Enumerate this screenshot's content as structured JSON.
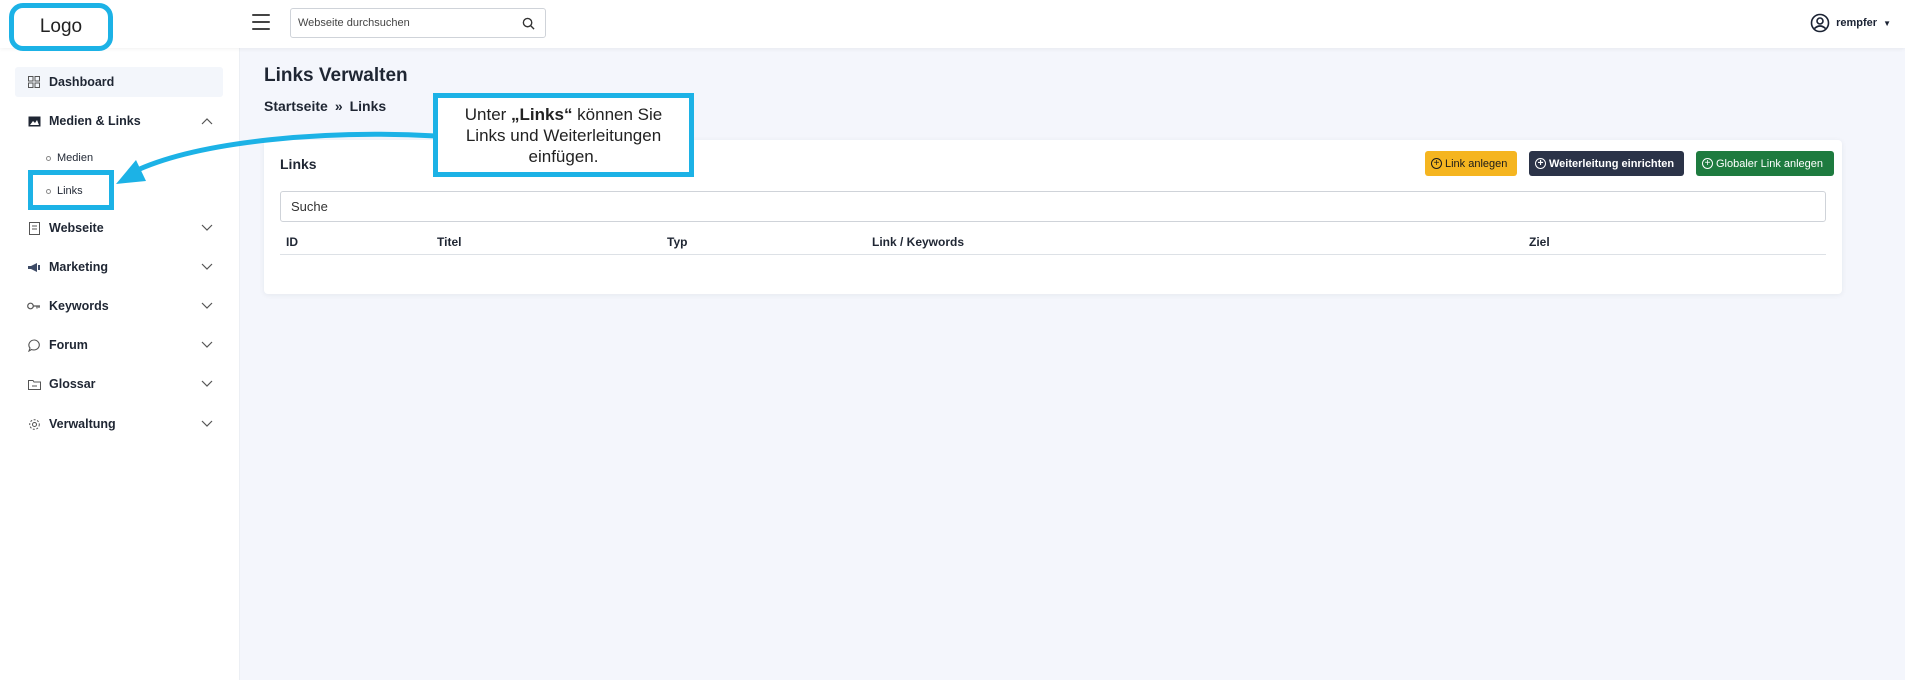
{
  "colors": {
    "accent": "#1cb2e6",
    "warning": "#f5b520",
    "dark": "#2b3348",
    "success": "#1e7b3f",
    "page_bg": "#f4f6fc"
  },
  "logo": {
    "text": "Logo"
  },
  "header": {
    "menu_icon": "hamburger-icon",
    "search": {
      "placeholder": "Webseite durchsuchen",
      "value": "",
      "icon": "search-icon"
    },
    "user": {
      "name": "rempfer",
      "icon": "user-circle-icon"
    }
  },
  "sidebar": {
    "items": [
      {
        "label": "Dashboard",
        "icon": "grid-icon"
      },
      {
        "label": "Medien & Links",
        "icon": "image-icon",
        "expanded": true
      },
      {
        "label": "Webseite",
        "icon": "document-icon"
      },
      {
        "label": "Marketing",
        "icon": "megaphone-icon"
      },
      {
        "label": "Keywords",
        "icon": "key-icon"
      },
      {
        "label": "Forum",
        "icon": "chat-icon"
      },
      {
        "label": "Glossar",
        "icon": "folder-icon"
      },
      {
        "label": "Verwaltung",
        "icon": "gear-icon"
      }
    ],
    "sub_items": [
      {
        "label": "Medien"
      },
      {
        "label": "Links"
      }
    ]
  },
  "main": {
    "title": "Links Verwalten",
    "breadcrumb": {
      "home": "Startseite",
      "separator": "»",
      "current": "Links"
    },
    "card": {
      "title": "Links",
      "buttons": {
        "create_link": "Link anlegen",
        "create_redirect": "Weiterleitung einrichten",
        "create_global_link": "Globaler Link anlegen"
      },
      "search_placeholder": "Suche",
      "columns": [
        "ID",
        "Titel",
        "Typ",
        "Link / Keywords",
        "Ziel"
      ]
    }
  },
  "callout": {
    "prefix": "Unter ",
    "highlight": "„Links“",
    "line1_suffix": " können Sie",
    "line2": "Links und Weiterleitungen",
    "line3": "einfügen."
  }
}
